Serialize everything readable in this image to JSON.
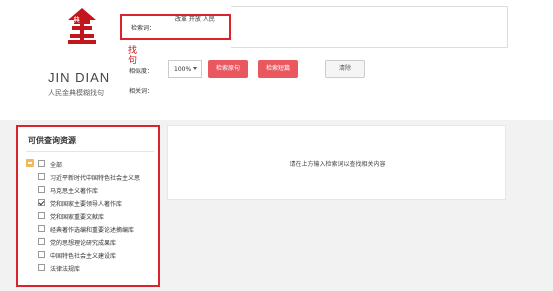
{
  "logo": {
    "char": "金典",
    "zhao": "找句",
    "jindian": "JIN DIAN",
    "tagline": "人民金典模糊找句",
    "red": "#c3161c"
  },
  "search": {
    "label": "检索词：",
    "value": "改革 开放 人民"
  },
  "similarity": {
    "label": "相似度：",
    "value": "100%"
  },
  "buttons": {
    "search_original": "检索原句",
    "search_similar": "检索短篇",
    "clear": "清除"
  },
  "related": {
    "label": "相关词："
  },
  "sidebar": {
    "title": "可供查询资源",
    "items": [
      {
        "label": "全部",
        "checked": false
      },
      {
        "label": "习近平新时代中国特色社会主义思",
        "checked": false
      },
      {
        "label": "马克思主义著作库",
        "checked": false
      },
      {
        "label": "党和国家主要领导人著作库",
        "checked": true
      },
      {
        "label": "党和国家重要文献库",
        "checked": false
      },
      {
        "label": "经典著作选编和重要论述摘编库",
        "checked": false
      },
      {
        "label": "党的思想理论研究成果库",
        "checked": false
      },
      {
        "label": "中国特色社会主义建设库",
        "checked": false
      },
      {
        "label": "法律法规库",
        "checked": false
      }
    ]
  },
  "result": {
    "hint": "请在上方输入检索词以查找相关内容"
  },
  "colors": {
    "accent_red": "#d9232d",
    "button_red": "#e9575f",
    "expand_orange": "#f4b85a"
  }
}
